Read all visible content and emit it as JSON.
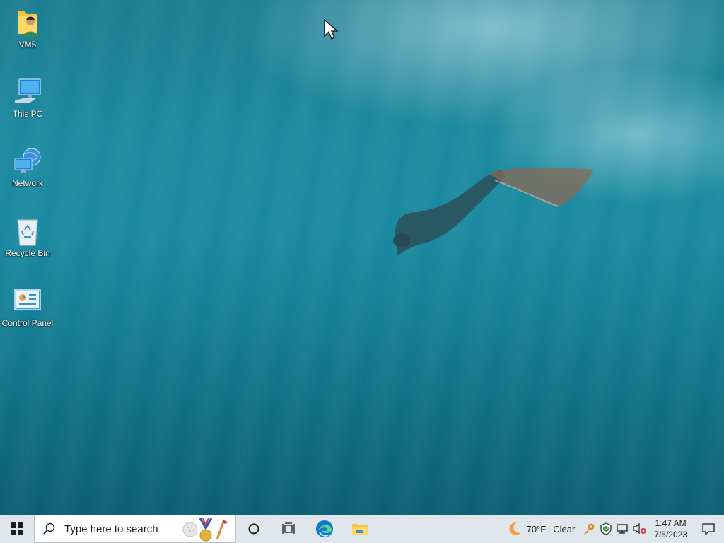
{
  "desktop": {
    "icons": [
      {
        "label": "VM5",
        "icon": "user-folder-icon"
      },
      {
        "label": "This PC",
        "icon": "computer-icon"
      },
      {
        "label": "Network",
        "icon": "network-icon"
      },
      {
        "label": "Recycle Bin",
        "icon": "recycle-bin-icon"
      },
      {
        "label": "Control Panel",
        "icon": "control-panel-icon"
      }
    ]
  },
  "taskbar": {
    "start_icon": "windows-logo-icon",
    "search": {
      "placeholder": "Type here to search",
      "icon": "search-icon"
    },
    "cortana_icon": "cortana-circle-icon",
    "task_view_icon": "task-view-icon",
    "pinned": [
      {
        "name": "Microsoft Edge",
        "icon": "edge-icon"
      },
      {
        "name": "File Explorer",
        "icon": "file-explorer-icon"
      }
    ],
    "weather": {
      "temp": "70°F",
      "condition": "Clear",
      "icon": "moon-icon"
    },
    "tray_icons": [
      "key-icon",
      "security-shield-icon",
      "network-disconnected-icon",
      "volume-muted-icon"
    ],
    "clock": {
      "time": "1:47 AM",
      "date": "7/6/2023"
    },
    "notification_icon": "notification-center-icon"
  },
  "colors": {
    "taskbar_bg": "#dfe6ec",
    "water_top": "#1d7d92",
    "water_bottom": "#0c5f73",
    "edge_blue": "#0f78d4",
    "folder_yellow": "#f4c542"
  }
}
